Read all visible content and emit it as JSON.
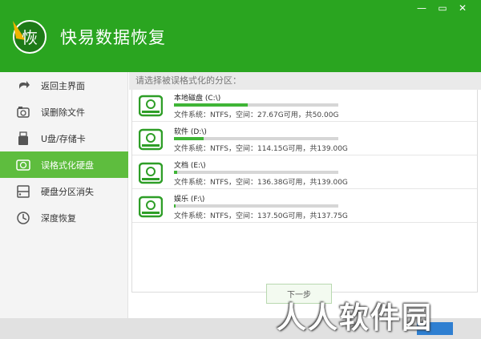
{
  "app": {
    "logo_char": "恢",
    "title": "快易数据恢复"
  },
  "window_controls": {
    "minimize": "—",
    "maximize": "▭",
    "close": "✕"
  },
  "sidebar": {
    "items": [
      {
        "label": "返回主界面",
        "icon": "back-arrow-icon",
        "active": false
      },
      {
        "label": "误删除文件",
        "icon": "trash-icon",
        "active": false
      },
      {
        "label": "U盘/存储卡",
        "icon": "usb-drive-icon",
        "active": false
      },
      {
        "label": "误格式化硬盘",
        "icon": "disk-icon",
        "active": true
      },
      {
        "label": "硬盘分区消失",
        "icon": "partition-icon",
        "active": false
      },
      {
        "label": "深度恢复",
        "icon": "deep-recover-icon",
        "active": false
      }
    ]
  },
  "main": {
    "prompt": "请选择被误格式化的分区：",
    "drives": [
      {
        "name": "本地磁盘 (C:\\)",
        "info": "文件系统：NTFS，空间：27.67G可用，共50.00G",
        "used_fraction": 0.45
      },
      {
        "name": "软件 (D:\\)",
        "info": "文件系统：NTFS，空间：114.15G可用，共139.00G",
        "used_fraction": 0.18
      },
      {
        "name": "文档 (E:\\)",
        "info": "文件系统：NTFS，空间：136.38G可用，共139.00G",
        "used_fraction": 0.02
      },
      {
        "name": "娱乐 (F:\\)",
        "info": "文件系统：NTFS，空间：137.50G可用，共137.75G",
        "used_fraction": 0.002
      }
    ],
    "next_button": "下一步"
  },
  "watermark": "人人软件园",
  "colors": {
    "header_green": "#2aa520",
    "active_green": "#5ebd3e",
    "bar_fill": "#3fb536"
  }
}
